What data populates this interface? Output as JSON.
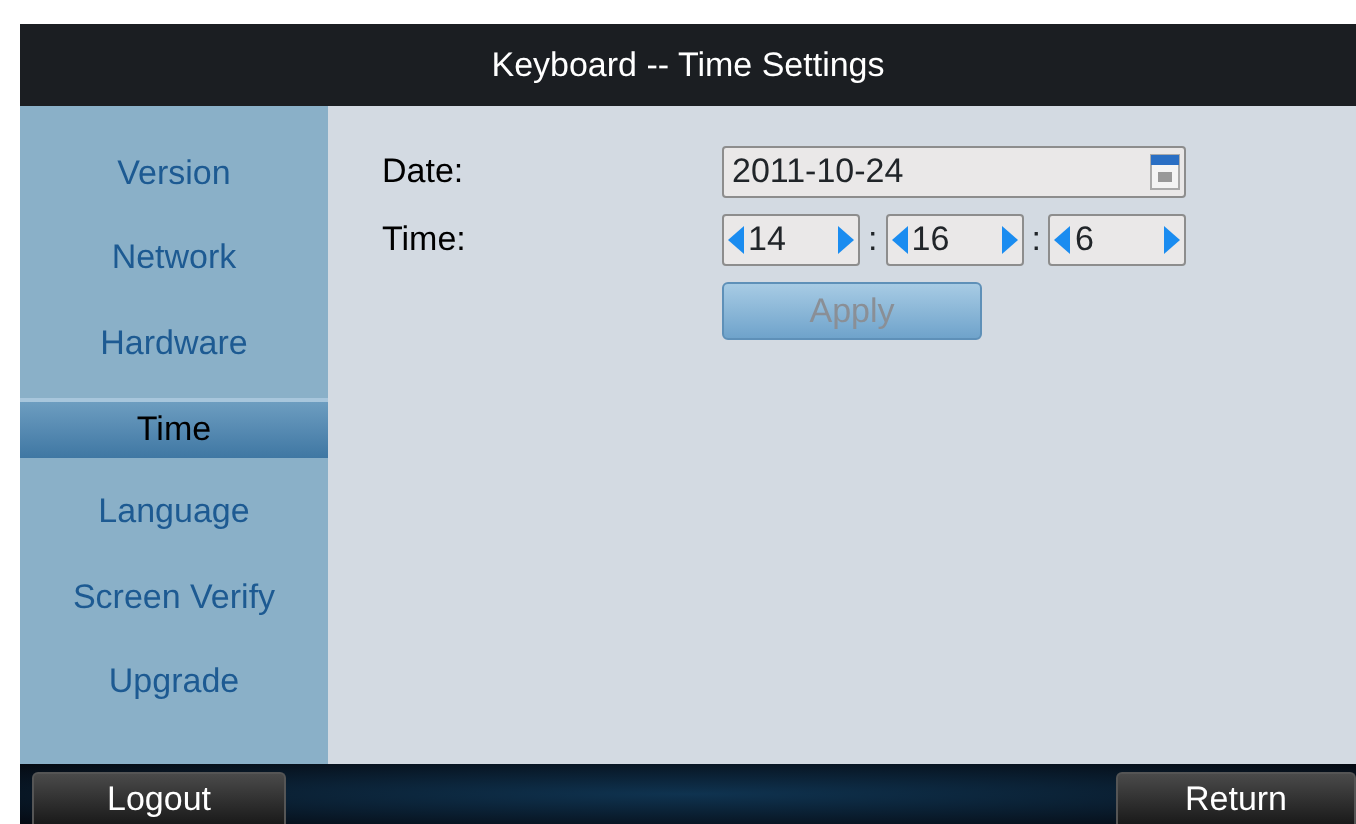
{
  "window": {
    "title": "Keyboard -- Time Settings"
  },
  "sidebar": {
    "items": [
      {
        "label": "Version",
        "selected": false
      },
      {
        "label": "Network",
        "selected": false
      },
      {
        "label": "Hardware",
        "selected": false
      },
      {
        "label": "Time",
        "selected": true
      },
      {
        "label": "Language",
        "selected": false
      },
      {
        "label": "Screen Verify",
        "selected": false
      },
      {
        "label": "Upgrade",
        "selected": false
      }
    ]
  },
  "form": {
    "date_label": "Date:",
    "date_value": "2011-10-24",
    "time_label": "Time:",
    "time_fields": [
      {
        "value": "14"
      },
      {
        "value": "16"
      },
      {
        "value": "6"
      }
    ],
    "separators": [
      ":",
      ":"
    ],
    "apply": {
      "label": "Apply",
      "disabled": true
    }
  },
  "footer": {
    "buttons": [
      "Logout",
      "Return"
    ]
  }
}
